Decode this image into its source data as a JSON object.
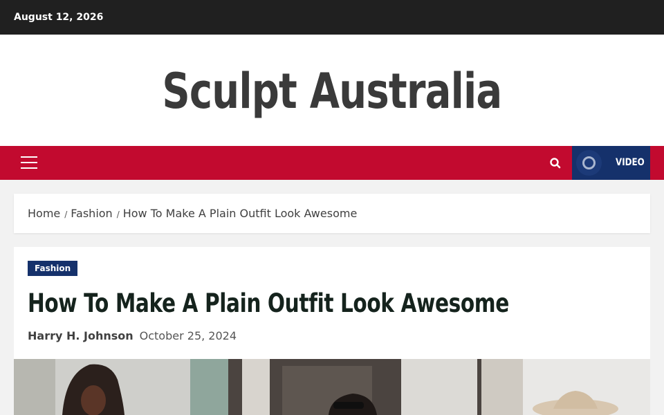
{
  "topbar": {
    "date": "August 12, 2026"
  },
  "site": {
    "title": "Sculpt Australia"
  },
  "nav": {
    "menu_icon": "hamburger-menu-icon",
    "search_icon": "search-icon",
    "video_icon": "video-ring-icon",
    "video_label": "VIDEO",
    "bar_color": "#c20a2f",
    "video_color": "#15316b"
  },
  "breadcrumb": {
    "items": [
      "Home",
      "Fashion",
      "How To Make A Plain Outfit Look Awesome"
    ],
    "separator": "/"
  },
  "article": {
    "category": "Fashion",
    "title": "How To Make A Plain Outfit Look Awesome",
    "author": "Harry H. Johnson",
    "date": "October 25, 2024"
  }
}
